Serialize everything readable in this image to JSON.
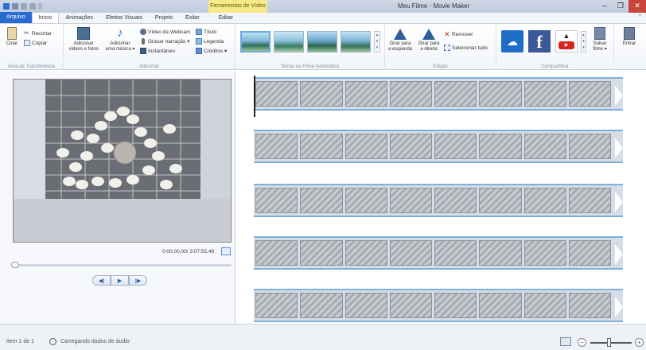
{
  "window": {
    "title": "Meu Filme - Movie Maker",
    "contextual_tab": "Ferramentas de Vídeo",
    "minimize": "–",
    "maximize": "❐",
    "close": "✕"
  },
  "tabs": [
    {
      "label": "Arquivo"
    },
    {
      "label": "Início"
    },
    {
      "label": "Animações"
    },
    {
      "label": "Efeitos Visuais"
    },
    {
      "label": "Projeto"
    },
    {
      "label": "Exibir"
    },
    {
      "label": "Editar"
    }
  ],
  "ribbon_minimize": "^",
  "ribbon": {
    "clipboard": {
      "label": "Área de Transferência",
      "paste": "Colar",
      "cut": "Recortar",
      "copy": "Copiar"
    },
    "add": {
      "label": "Adicionar",
      "add_videos_line1": "Adicionar",
      "add_videos_line2": "vídeos e fotos",
      "add_music_line1": "Adicionar",
      "add_music_line2": "uma música ▾",
      "webcam": "Vídeo da Webcam",
      "narration": "Gravar narração ▾",
      "snapshot": "Instantâneo",
      "title": "Título",
      "caption": "Legenda",
      "credits": "Créditos ▾"
    },
    "themes": {
      "label": "Temas de Filme Automático"
    },
    "editing": {
      "label": "Edição",
      "rotate_left_line1": "Girar para",
      "rotate_left_line2": "a esquerda",
      "rotate_right_line1": "Girar para",
      "rotate_right_line2": "a direita",
      "remove": "Remover",
      "select_all": "Selecionar tudo"
    },
    "share": {
      "label": "Compartilhar",
      "save_movie_line1": "Salvar",
      "save_movie_line2": "filme ▾"
    },
    "signin": {
      "label": "Entrar"
    }
  },
  "player": {
    "timecode": "0:00:00,00/ 3:07:55,48",
    "progress": 0.0
  },
  "storyboard": {
    "strip_count": 5,
    "frames_per_strip": 8
  },
  "status": {
    "item_count": "Item 1 de 1",
    "message": "Carregando dados de áudio",
    "zoom_out": "−",
    "zoom_in": "+"
  },
  "colors": {
    "file_tab": "#2a6bd1",
    "contextual": "#f6e98b",
    "close": "#c9453b",
    "strip_border": "#7fb0d9"
  }
}
